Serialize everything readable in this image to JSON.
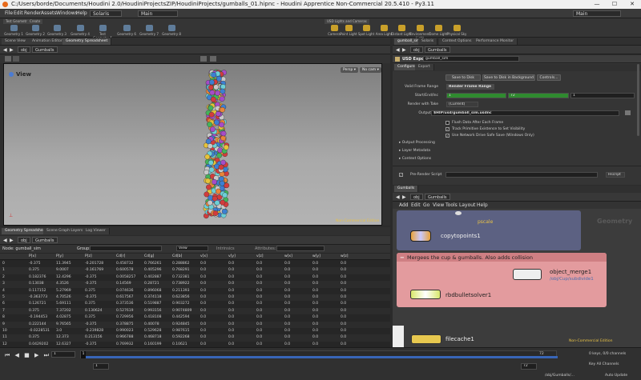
{
  "titlebar": {
    "text": "C:/Users/borde/Documents/Houdini 2.0/HoudiniProjectsZIP/HoudiniProjects/gumballs_01.hipnc - Houdini Apprentice Non-Commercial 20.5.410 - Py3.11",
    "minimize": "—",
    "maximize": "☐",
    "close": "✕"
  },
  "menu": {
    "items": [
      "File",
      "Edit",
      "Render",
      "Assets",
      "Windows",
      "Help"
    ],
    "desktop": "Solaris",
    "context": "Main",
    "right_context": "Main"
  },
  "shelf": {
    "left_tabs": [
      "Test Geometry",
      "Create"
    ],
    "tools": [
      "Geometry 1",
      "Geometry 2",
      "Geometry 3",
      "Geometry 4",
      "Test Geometry 5",
      "Geometry 6",
      "Geometry 7",
      "Geometry 8"
    ],
    "right_tabs": [
      "USD Lights and Cameras"
    ],
    "light_tools": [
      "Camera",
      "Point Light",
      "Spot Light",
      "Area Light",
      "Distant Light",
      "Environment Light",
      "Dome Light",
      "Physical Sky"
    ]
  },
  "left_pane_tabs": [
    "Scene View",
    "Animation Editor",
    "Geometry Spreadsheet"
  ],
  "right_pane_tabs": [
    "gumball_sim",
    "Solaris",
    "Context Options Editor",
    "Performance Monitor"
  ],
  "viewport": {
    "path_obj": "obj",
    "path_node": "Gumballs",
    "title": "View",
    "persp": "Persp ▾",
    "cam": "No cam ▾",
    "watermark": "Non-Commercial Edition"
  },
  "spreadsheet": {
    "tabs": [
      "Geometry Spreadsheet",
      "Scene Graph Layers",
      "Log Viewer"
    ],
    "path_obj": "obj",
    "path_node": "Gumballs",
    "node_label": "Node: gumball_sim",
    "group_label": "Group:",
    "view_label": "View",
    "intrinsics_label": "Intrinsics",
    "attributes_label": "Attributes:",
    "columns": [
      "",
      "P[x]",
      "P[y]",
      "P[z]",
      "Cd[r]",
      "Cd[g]",
      "Cd[b]",
      "v[x]",
      "v[y]",
      "v[z]",
      "w[x]",
      "w[y]",
      "w[z]"
    ],
    "rows": [
      [
        "0",
        "-0.375",
        "11.3945",
        "-0.201728",
        "0.458732",
        "0.766261",
        "0.288862",
        "0.0",
        "0.0",
        "0.0",
        "0.0",
        "0.0",
        "0.0"
      ],
      [
        "1",
        "0.375",
        "9.0007",
        "-0.161769",
        "0.600578",
        "0.405296",
        "0.768291",
        "0.0",
        "0.0",
        "0.0",
        "0.0",
        "0.0",
        "0.0"
      ],
      [
        "2",
        "0.182376",
        "12.4296",
        "-0.375",
        "0.0058257",
        "0.402887",
        "0.732381",
        "0.0",
        "0.0",
        "0.0",
        "0.0",
        "0.0",
        "0.0"
      ],
      [
        "3",
        "0.13038",
        "4.3526",
        "-0.375",
        "0.14569",
        "0.28721",
        "0.738922",
        "0.0",
        "0.0",
        "0.0",
        "0.0",
        "0.0",
        "0.0"
      ],
      [
        "4",
        "0.117152",
        "5.27969",
        "0.375",
        "0.074636",
        "0.896068",
        "0.211393",
        "0.0",
        "0.0",
        "0.0",
        "0.0",
        "0.0",
        "0.0"
      ],
      [
        "5",
        "-0.363773",
        "4.70526",
        "-0.375",
        "0.617567",
        "0.374118",
        "0.623856",
        "0.0",
        "0.0",
        "0.0",
        "0.0",
        "0.0",
        "0.0"
      ],
      [
        "6",
        "0.126721",
        "5.69111",
        "0.375",
        "0.373536",
        "0.519887",
        "0.903272",
        "0.0",
        "0.0",
        "0.0",
        "0.0",
        "0.0",
        "0.0"
      ],
      [
        "7",
        "0.375",
        "7.37202",
        "0.130624",
        "0.527619",
        "0.993156",
        "0.9074809",
        "0.0",
        "0.0",
        "0.0",
        "0.0",
        "0.0",
        "0.0"
      ],
      [
        "8",
        "-0.194453",
        "4.02875",
        "0.375",
        "0.729956",
        "0.418108",
        "0.442594",
        "0.0",
        "0.0",
        "0.0",
        "0.0",
        "0.0",
        "0.0"
      ],
      [
        "9",
        "0.222144",
        "9.76565",
        "-0.375",
        "0.378875",
        "0.40078",
        "0.924845",
        "0.0",
        "0.0",
        "0.0",
        "0.0",
        "0.0",
        "0.0"
      ],
      [
        "10",
        "-0.0228531",
        "3.0",
        "-0.239828",
        "0.990023",
        "0.529628",
        "0.987615",
        "0.0",
        "0.0",
        "0.0",
        "0.0",
        "0.0",
        "0.0"
      ],
      [
        "11",
        "0.375",
        "12.373",
        "0.213156",
        "0.966788",
        "0.468718",
        "0.592268",
        "0.0",
        "0.0",
        "0.0",
        "0.0",
        "0.0",
        "0.0"
      ],
      [
        "12",
        "0.0429202",
        "12.6327",
        "-0.375",
        "0.769932",
        "0.160199",
        "0.10621",
        "0.0",
        "0.0",
        "0.0",
        "0.0",
        "0.0",
        "0.0"
      ]
    ]
  },
  "params": {
    "type_label": "USD Export",
    "node_name": "gumball_sim",
    "tabs": [
      "Configure",
      "Export"
    ],
    "buttons": [
      "Save to Disk",
      "Save to Disk in Background",
      "Controls..."
    ],
    "valid_frame_range_label": "Valid Frame Range",
    "valid_frame_range_value": "Render Frame Range",
    "start_end_inc_label": "Start/End/Inc",
    "start": "1",
    "end": "72",
    "inc": "1",
    "render_with_take_label": "Render with Take",
    "render_with_take_value": "(Current)",
    "output_file_label": "Output File",
    "output_file_value": "$HIP/usd/gumball_sim.usdnc",
    "checkboxes": [
      {
        "label": "Flush Data After Each Frame",
        "checked": false
      },
      {
        "label": "Track Primitive Existence to Set Visibility",
        "checked": true
      },
      {
        "label": "Use Network Drive Safe Save (Windows Only)",
        "checked": true
      }
    ],
    "sections": [
      "Output Processing",
      "Layer Metadata",
      "Context Options"
    ],
    "prerender_label": "Pre-Render Script",
    "prerender_lang": "Hscript"
  },
  "network": {
    "path_obj": "obj",
    "path_node": "Gumballs",
    "menu": [
      "Add",
      "Edit",
      "Go",
      "View",
      "Tools",
      "Layout",
      "Help"
    ],
    "context_label": "Geometry",
    "nodes": {
      "pscale": "pscale",
      "copytopoints": "copytopoints1",
      "object_merge": "object_merge1",
      "object_merge_path": "/obj/Cup/subdivide1",
      "rbd": "rbdbulletsolver1",
      "filecache": "filecache1"
    },
    "netbox_title": "Mergees the cup & gumballs. Also adds collision",
    "watermark": "Non-Commercial Edition"
  },
  "timeline": {
    "frame": "1",
    "start": "1",
    "end": "72",
    "end2": "72",
    "start2": "1",
    "channels": "0 keys, 0/0 channels",
    "keyall": "Key All Channels",
    "auto_update": "Auto Update",
    "path": "/obj/Gumballs/..."
  }
}
